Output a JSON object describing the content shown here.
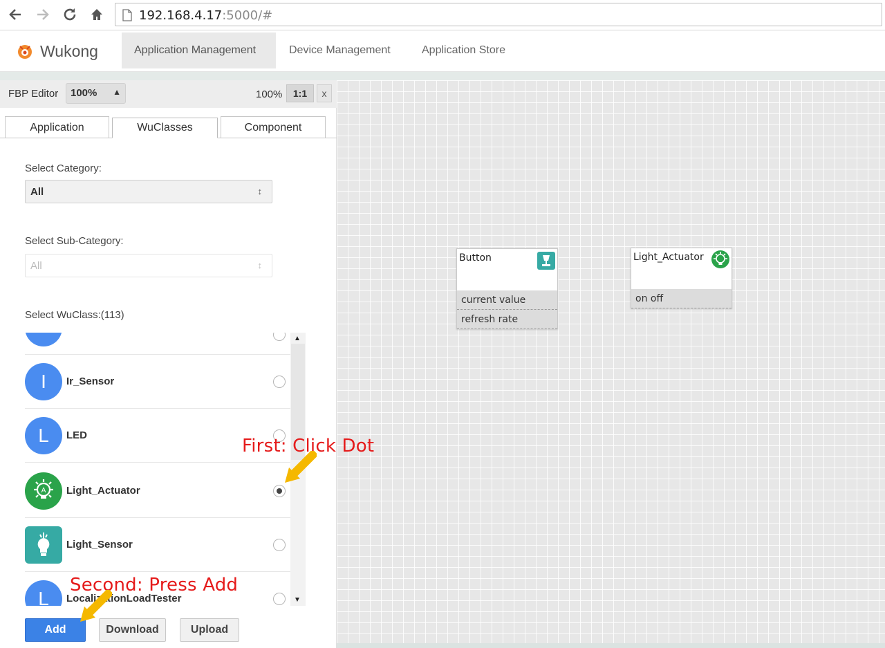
{
  "browser": {
    "url_host": "192.168.4.17",
    "url_rest": ":5000/#"
  },
  "app": {
    "brand": "Wukong",
    "nav": [
      "Application Management",
      "Device Management",
      "Application Store"
    ],
    "active_nav": "Application Management"
  },
  "editor": {
    "label": "FBP Editor",
    "zoom_select": "100%",
    "zoom_pct": "100%",
    "one_to_one": "1:1",
    "close": "x"
  },
  "panel": {
    "tabs": [
      "Application",
      "WuClasses",
      "Component"
    ],
    "active_tab": "WuClasses",
    "category_label": "Select Category:",
    "category_value": "All",
    "subcategory_label": "Select Sub-Category:",
    "subcategory_value": "All",
    "wuclass_label": "Select WuClass:(113)",
    "wuclasses": [
      {
        "letter": "",
        "name": "",
        "icon": "partial-blue-circle"
      },
      {
        "letter": "I",
        "name": "Ir_Sensor",
        "icon": "letter-circle-icon",
        "selected": false
      },
      {
        "letter": "L",
        "name": "LED",
        "icon": "letter-circle-icon",
        "selected": false
      },
      {
        "letter": "",
        "name": "Light_Actuator",
        "icon": "light-actuator-icon",
        "selected": true
      },
      {
        "letter": "",
        "name": "Light_Sensor",
        "icon": "light-sensor-icon",
        "selected": false
      },
      {
        "letter": "L",
        "name": "LocalizationLoadTester",
        "icon": "letter-circle-icon",
        "selected": false
      }
    ],
    "buttons": {
      "add": "Add",
      "download": "Download",
      "upload": "Upload"
    }
  },
  "canvas": {
    "nodes": [
      {
        "title": "Button",
        "icon": "button-icon",
        "props": [
          "current value",
          "refresh rate"
        ]
      },
      {
        "title": "Light_Actuator",
        "icon": "light-actuator-icon",
        "props": [
          "on off"
        ]
      }
    ]
  },
  "annotations": {
    "first": "First: Click Dot",
    "second": "Second: Press Add",
    "color": "#e51b1b",
    "arrow_color": "#f5b800"
  }
}
